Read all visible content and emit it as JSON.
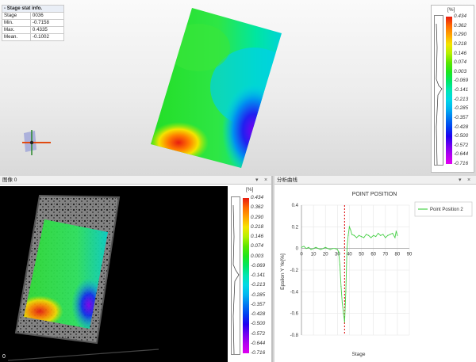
{
  "stat_info": {
    "title": "Stage stat info.",
    "collapse_glyph": "-",
    "rows": [
      {
        "label": "Stage",
        "value": "0036"
      },
      {
        "label": "Min.",
        "value": "-0.7158"
      },
      {
        "label": "Max.",
        "value": "0.4335"
      },
      {
        "label": "Mean.",
        "value": "-0.1002"
      }
    ]
  },
  "colorbar": {
    "unit": "[%]",
    "ticks": [
      "0.434",
      "0.362",
      "0.290",
      "0.218",
      "0.146",
      "0.074",
      "0.003",
      "-0.069",
      "-0.141",
      "-0.213",
      "-0.285",
      "-0.357",
      "-0.428",
      "-0.500",
      "-0.572",
      "-0.644",
      "-0.716"
    ],
    "colors": [
      "#e81c10",
      "#ff6a00",
      "#ffa500",
      "#f4e400",
      "#b4f000",
      "#5ae600",
      "#1ee61e",
      "#00e664",
      "#00e6b4",
      "#00d8e6",
      "#00b4f0",
      "#0078f0",
      "#0040f0",
      "#2000f0",
      "#7000f0",
      "#b000f0",
      "#e000f0"
    ]
  },
  "image_panel": {
    "title": "图像 0",
    "pin": "▾",
    "close": "×",
    "frame_index": "0"
  },
  "chart_panel": {
    "title": "分析曲线",
    "pin": "▾",
    "close": "×"
  },
  "axes_icon": "axes-triad-icon",
  "chart_data": {
    "type": "line",
    "title": "POINT POSITION",
    "xlabel": "Stage",
    "ylabel": "Epsilon Y Ye[%]",
    "xlim": [
      0,
      90
    ],
    "ylim": [
      -0.8,
      0.4
    ],
    "xticks": [
      "0",
      "10",
      "20",
      "30",
      "40",
      "50",
      "60",
      "70",
      "80",
      "90"
    ],
    "yticks": [
      "0.4",
      "0.2",
      "0",
      "-0.2",
      "-0.4",
      "-0.6",
      "-0.8"
    ],
    "grid": true,
    "legend_position": "right",
    "current_stage": 36,
    "series": [
      {
        "name": "Point Position 2",
        "color": "#4ad14a",
        "x": [
          0,
          2,
          4,
          6,
          8,
          10,
          12,
          14,
          16,
          18,
          20,
          22,
          24,
          26,
          28,
          30,
          31,
          32,
          33,
          34,
          35,
          36,
          37,
          38,
          39,
          40,
          41,
          42,
          44,
          46,
          48,
          50,
          52,
          54,
          56,
          58,
          60,
          62,
          64,
          66,
          68,
          70,
          72,
          74,
          76,
          78,
          79,
          80
        ],
        "values": [
          0.01,
          0.02,
          0.0,
          0.01,
          -0.01,
          0.0,
          0.01,
          0.0,
          -0.01,
          0.0,
          0.01,
          0.0,
          -0.01,
          0.0,
          0.0,
          -0.01,
          -0.03,
          -0.15,
          -0.35,
          -0.5,
          -0.6,
          -0.68,
          -0.4,
          0.0,
          0.12,
          0.2,
          0.17,
          0.13,
          0.12,
          0.1,
          0.12,
          0.11,
          0.1,
          0.13,
          0.12,
          0.1,
          0.12,
          0.11,
          0.14,
          0.12,
          0.13,
          0.1,
          0.12,
          0.13,
          0.14,
          0.1,
          0.16,
          0.12
        ]
      }
    ]
  }
}
